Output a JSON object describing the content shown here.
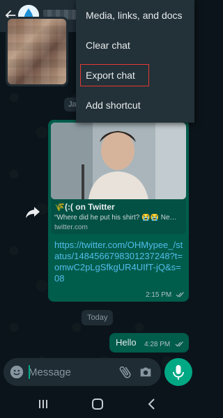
{
  "menu": {
    "items": [
      {
        "label": "Media, links, and docs"
      },
      {
        "label": "Clear chat"
      },
      {
        "label": "Export chat"
      },
      {
        "label": "Add shortcut"
      }
    ]
  },
  "chat": {
    "date_chip": "Ja",
    "link_message": {
      "preview_title": "🌾(:( on Twitter",
      "preview_desc": "“Where did he put his shirt? 😭😭 Ne…",
      "preview_domain": "twitter.com",
      "url": "https://twitter.com/OHMypee_/status/1484566798301237248?t=omwC2pLgSfkgUR4UIfT-jQ&s=08",
      "time": "2:15 PM"
    },
    "today_chip": "Today",
    "hello_message": {
      "text": "Hello",
      "time": "4:28 PM"
    }
  },
  "composer": {
    "placeholder": "Message"
  },
  "colors": {
    "header_bg": "#1f2c34",
    "outgoing_bubble": "#005c4b",
    "accent": "#00a884",
    "link": "#53bdeb",
    "highlight_box": "#e53935"
  }
}
